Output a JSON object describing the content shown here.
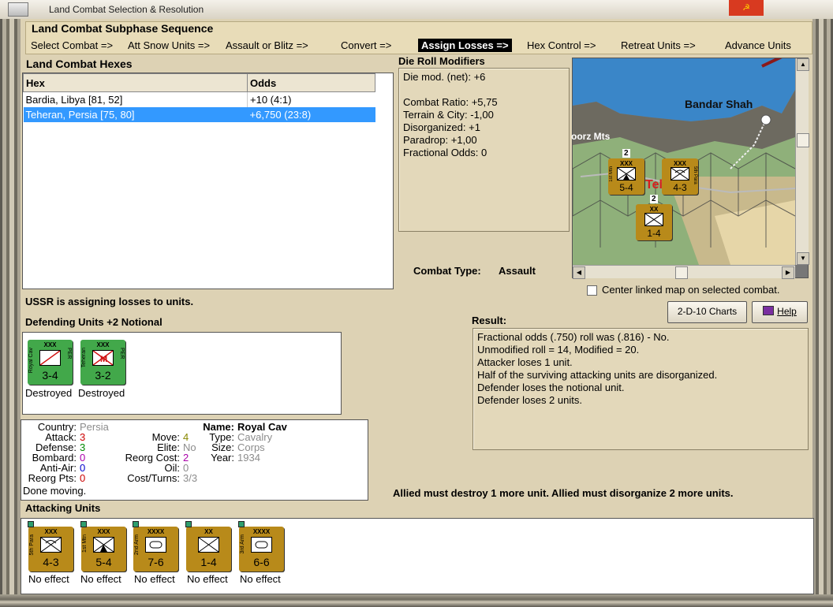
{
  "window": {
    "title": "Land Combat Selection & Resolution"
  },
  "subphase": {
    "heading": "Land Combat Subphase Sequence",
    "steps": [
      {
        "label": "Select Combat =>"
      },
      {
        "label": "Att Snow Units =>"
      },
      {
        "label": "Assault or Blitz =>"
      },
      {
        "label": "Convert =>"
      },
      {
        "label": "Assign Losses =>"
      },
      {
        "label": "Hex Control =>"
      },
      {
        "label": "Retreat Units =>"
      },
      {
        "label": "Advance Units"
      }
    ]
  },
  "hexes": {
    "heading": "Land Combat Hexes",
    "columns": [
      "Hex",
      "Odds"
    ],
    "rows": [
      {
        "hex": "Bardia, Libya [81, 52]",
        "odds": "+10 (4:1)"
      },
      {
        "hex": "Teheran, Persia [75, 80]",
        "odds": "+6,750 (23:8)"
      }
    ]
  },
  "modifiers": {
    "heading": "Die Roll Modifiers",
    "lines": [
      "Die mod. (net): +6",
      "",
      "Combat Ratio: +5,75",
      "Terrain & City: -1,00",
      "Disorganized: +1",
      "Paradrop: +1,00",
      "Fractional Odds: 0"
    ]
  },
  "map": {
    "place_label": "Bandar Shah",
    "mountain_label": "oorz Mts",
    "city_fragment": "Tel",
    "stacks": [
      {
        "size": "XXX",
        "side": "1st Mtn",
        "strength": "5-4",
        "count": "2"
      },
      {
        "size": "XXX",
        "side": "5th Para",
        "strength": "4-3"
      },
      {
        "size": "XX",
        "side": "",
        "strength": "1-4",
        "count": "2"
      }
    ]
  },
  "center_map": {
    "label": "Center linked map on selected combat.",
    "checked": false
  },
  "combat_type": {
    "label": "Combat Type:",
    "value": "Assault"
  },
  "status_message": "USSR is assigning losses to units.",
  "defending": {
    "heading": "Defending Units +2 Notional",
    "units": [
      {
        "size": "XXX",
        "name": "Royal Cav",
        "nation": "PER",
        "strength": "3-4",
        "status": "Destroyed"
      },
      {
        "size": "XXX",
        "name": "Teheran",
        "nation": "PER",
        "strength": "3-2",
        "status": "Destroyed"
      }
    ]
  },
  "buttons": {
    "charts": "2-D-10 Charts",
    "help": "Help"
  },
  "result": {
    "heading": "Result:",
    "lines": [
      "Fractional odds (.750) roll was (.816)  - No.",
      "Unmodified roll = 14, Modified = 20.",
      "Attacker loses 1 unit.",
      "Half of the surviving attacking units are disorganized.",
      "Defender loses the notional unit.",
      "Defender loses 2 units."
    ]
  },
  "unit_info": {
    "left": [
      {
        "label": "Country:",
        "value": "Persia",
        "color": "#8c8c8c"
      },
      {
        "label": "Attack:",
        "value": "3",
        "color": "#cc0000"
      },
      {
        "label": "Defense:",
        "value": "3",
        "color": "#008800"
      },
      {
        "label": "Bombard:",
        "value": "0",
        "color": "#aa00aa"
      },
      {
        "label": "Anti-Air:",
        "value": "0",
        "color": "#0000cc"
      },
      {
        "label": "Reorg Pts:",
        "value": "0",
        "color": "#cc0000"
      }
    ],
    "mid": [
      {
        "label": "Move:",
        "value": "4",
        "color": "#888800"
      },
      {
        "label": "Elite:",
        "value": "No",
        "color": "#8c8c8c"
      },
      {
        "label": "Reorg Cost:",
        "value": "2",
        "color": "#aa00aa"
      },
      {
        "label": "Oil:",
        "value": "0",
        "color": "#8c8c8c"
      },
      {
        "label": "Cost/Turns:",
        "value": "3/3",
        "color": "#8c8c8c"
      }
    ],
    "name_label": "Name:",
    "name_value": "Royal Cav",
    "right": [
      {
        "label": "Type:",
        "value": "Cavalry"
      },
      {
        "label": "Size:",
        "value": "Corps"
      },
      {
        "label": "Year:",
        "value": "1934"
      }
    ],
    "done": "Done moving."
  },
  "requirement": "Allied must destroy 1 more unit. Allied must disorganize 2 more units.",
  "attacking": {
    "heading": "Attacking Units",
    "units": [
      {
        "size": "XXX",
        "name": "5th Para",
        "strength": "4-3",
        "status": "No effect"
      },
      {
        "size": "XXX",
        "name": "1st Mtn",
        "strength": "5-4",
        "status": "No effect"
      },
      {
        "size": "XXXX",
        "name": "2nd Arm",
        "strength": "7-6",
        "status": "No effect"
      },
      {
        "size": "XX",
        "name": "",
        "strength": "1-4",
        "status": "No effect"
      },
      {
        "size": "XXXX",
        "name": "3rd Arm",
        "strength": "6-6",
        "status": "No effect"
      }
    ]
  },
  "colors": {
    "accent_selected": "#3399ff",
    "defender_counter": "#42a84a",
    "attacker_counter": "#b88a1a",
    "panel_bg": "#ddd2b4"
  }
}
